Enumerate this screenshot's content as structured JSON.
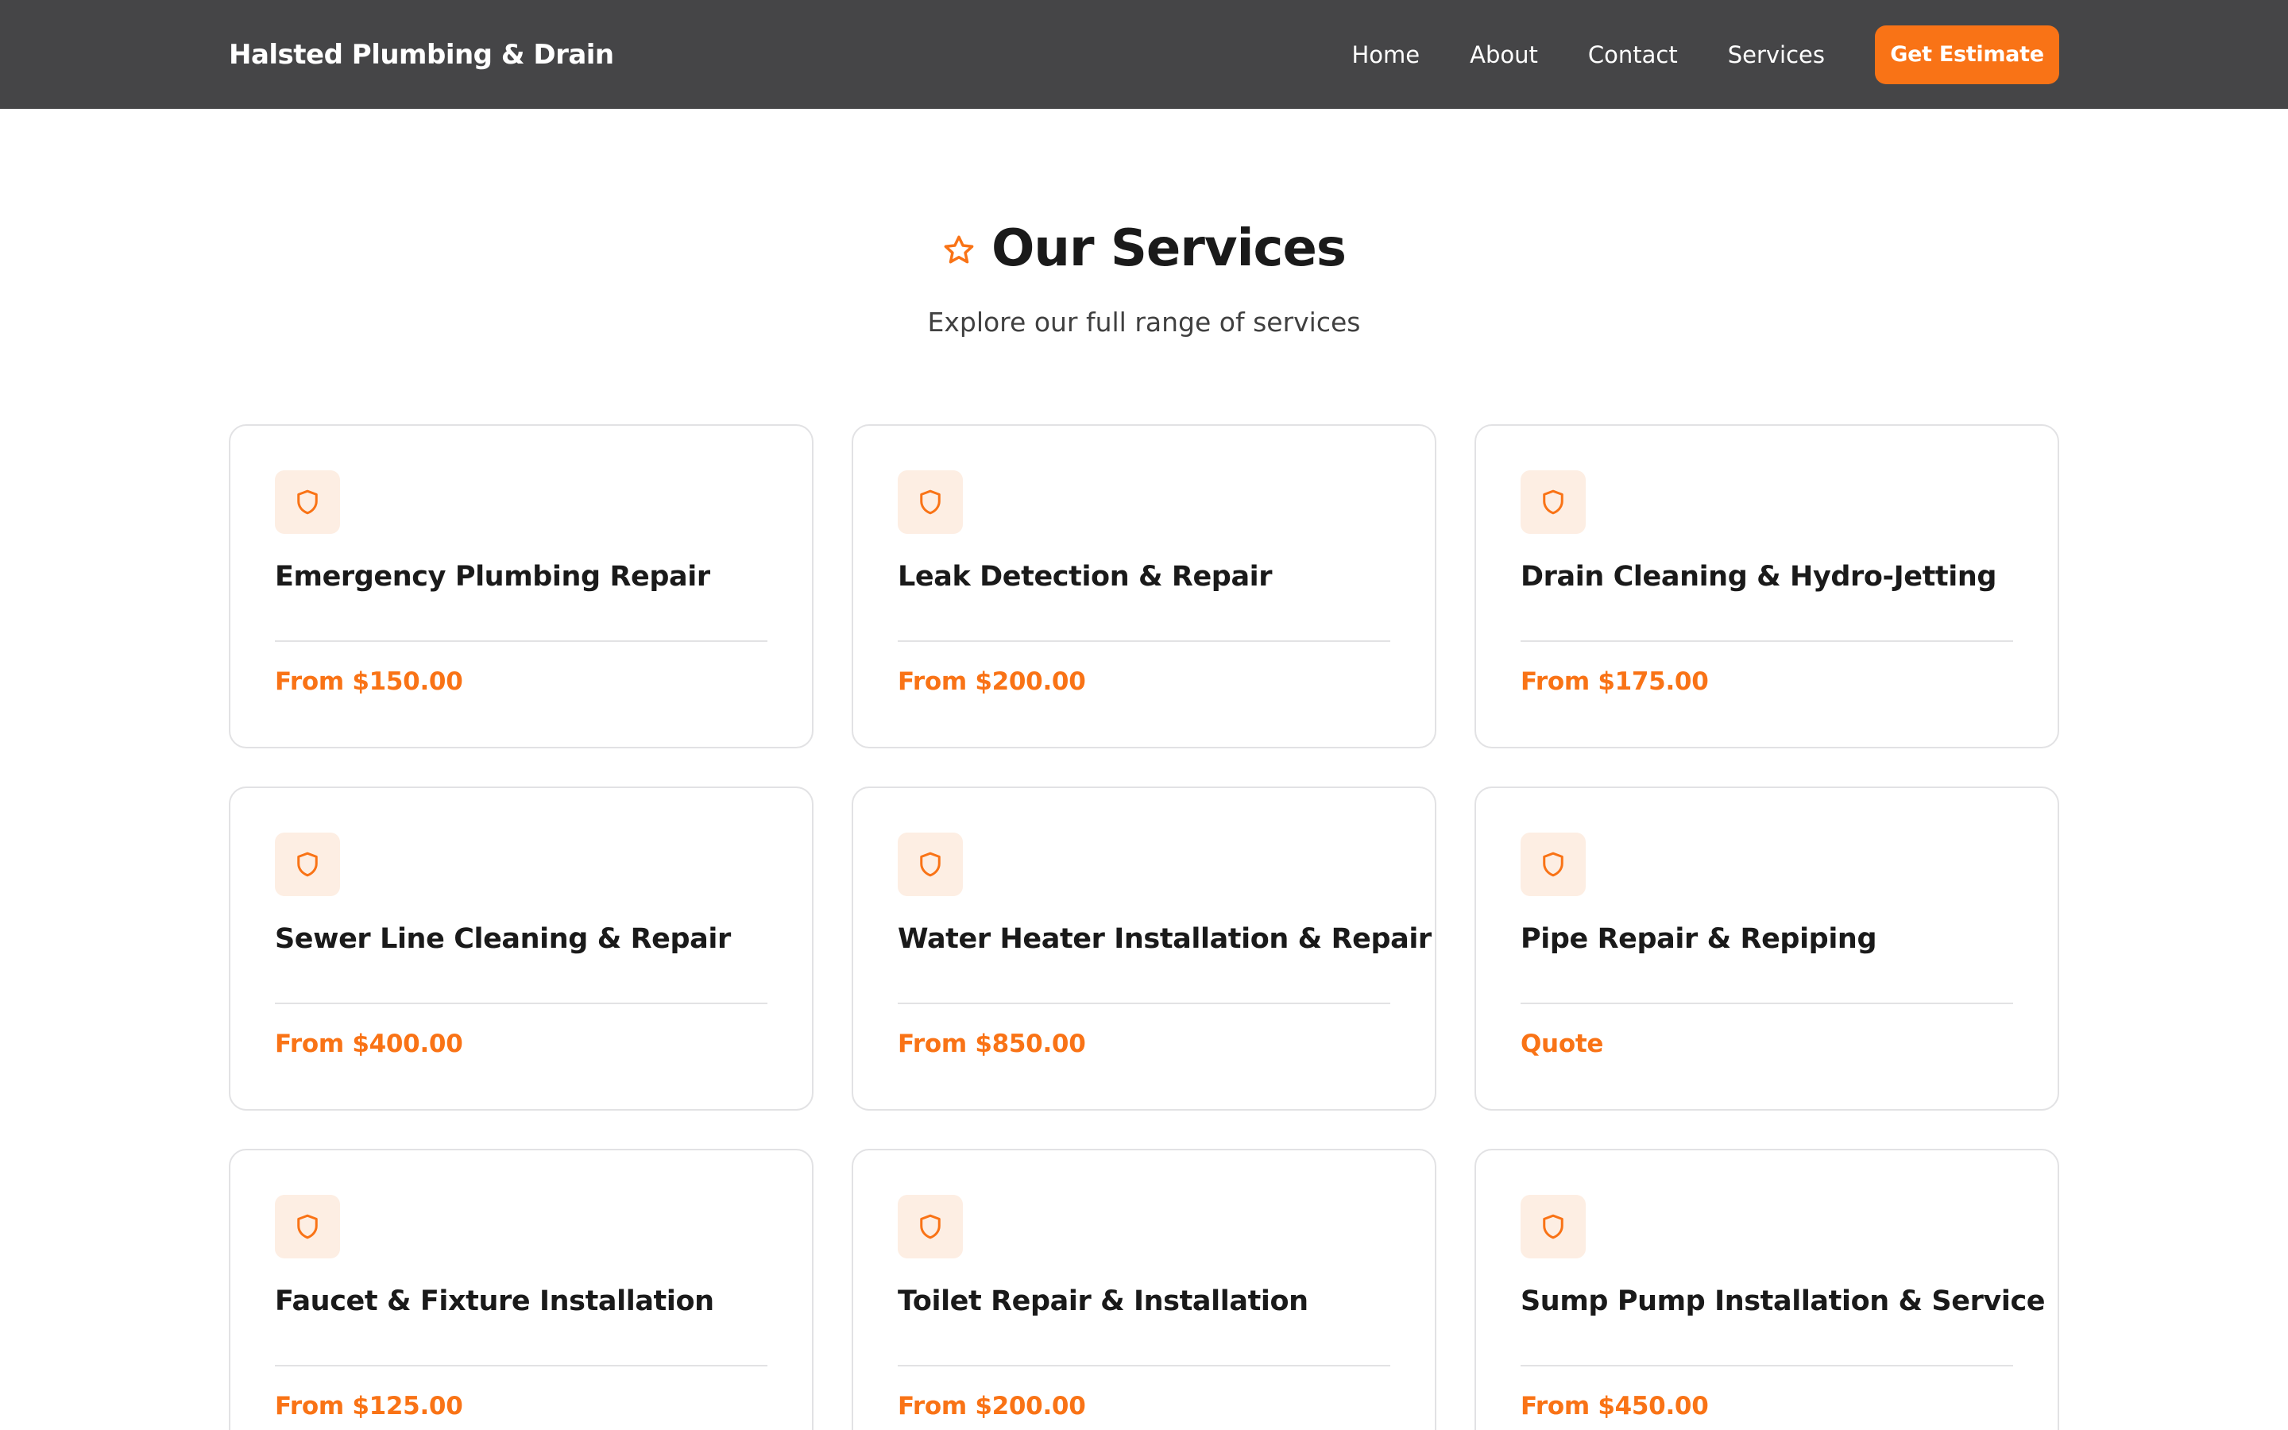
{
  "header": {
    "brand": "Halsted Plumbing & Drain",
    "nav": [
      "Home",
      "About",
      "Contact",
      "Services"
    ],
    "cta_label": "Get Estimate"
  },
  "section": {
    "title": "Our Services",
    "title_icon": "star-icon",
    "subtitle": "Explore our full range of services"
  },
  "services": [
    {
      "name": "Emergency Plumbing Repair",
      "price": "From $150.00",
      "icon": "shield-icon"
    },
    {
      "name": "Leak Detection & Repair",
      "price": "From $200.00",
      "icon": "shield-icon"
    },
    {
      "name": "Drain Cleaning & Hydro-Jetting",
      "price": "From $175.00",
      "icon": "shield-icon"
    },
    {
      "name": "Sewer Line Cleaning & Repair",
      "price": "From $400.00",
      "icon": "shield-icon"
    },
    {
      "name": "Water Heater Installation & Repair",
      "price": "From $850.00",
      "icon": "shield-icon"
    },
    {
      "name": "Pipe Repair & Repiping",
      "price": "Quote",
      "icon": "shield-icon"
    },
    {
      "name": "Faucet & Fixture Installation",
      "price": "From $125.00",
      "icon": "shield-icon"
    },
    {
      "name": "Toilet Repair & Installation",
      "price": "From $200.00",
      "icon": "shield-icon"
    },
    {
      "name": "Sump Pump Installation & Service",
      "price": "From $450.00",
      "icon": "shield-icon"
    }
  ],
  "colors": {
    "accent": "#f97316",
    "navbar": "#454547",
    "icon_bg": "#fdeee3"
  }
}
